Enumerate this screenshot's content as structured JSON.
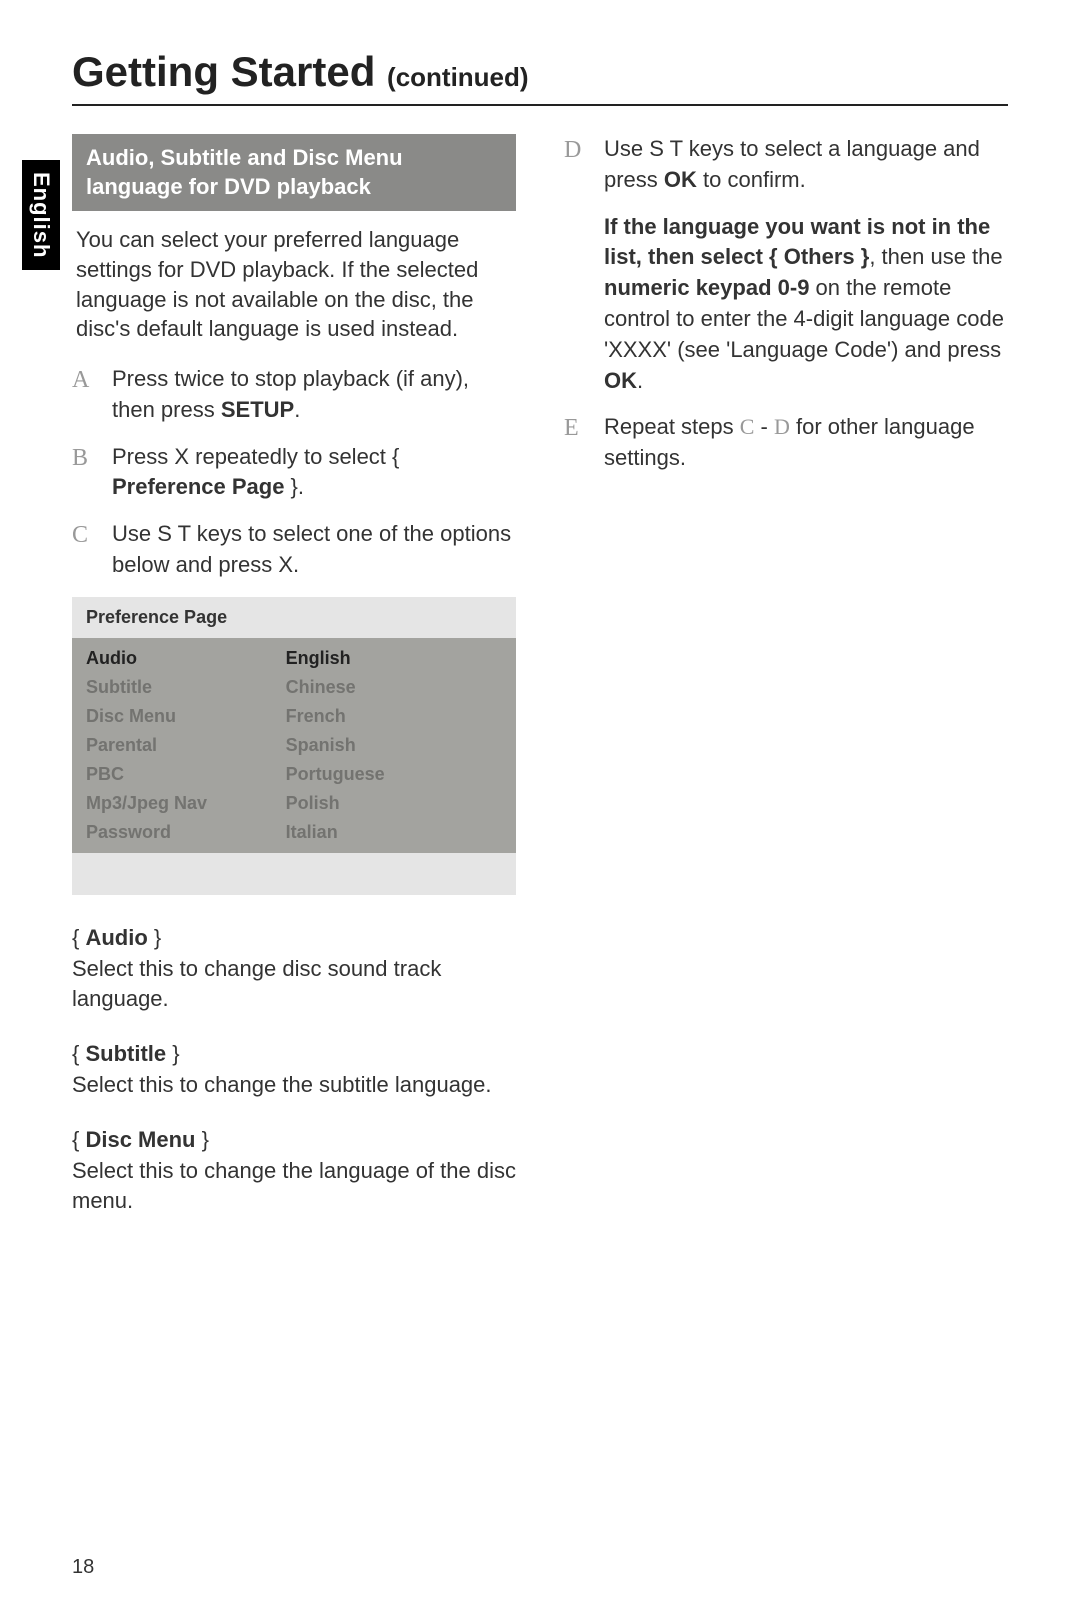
{
  "language_tab": "English",
  "heading": {
    "main": "Getting Started",
    "sub": "(continued)"
  },
  "left": {
    "section_header": "Audio, Subtitle and Disc Menu language for DVD playback",
    "intro": "You can select your preferred language settings for DVD playback. If the selected language is not available on the disc, the disc's default language is used instead.",
    "steps": [
      {
        "letter": "A",
        "pre": "Press ",
        "mid": " twice to stop playback (if any), then press ",
        "bold1": "SETUP",
        "post": "."
      },
      {
        "letter": "B",
        "pre": "Press  X repeatedly to select { ",
        "bold1": "Preference Page",
        "post": " }."
      },
      {
        "letter": "C",
        "pre": "Use  S T  keys to select one of the options below and press  X."
      }
    ],
    "pref_table": {
      "title": "Preference Page",
      "rows": [
        {
          "c1": "Audio",
          "c2": "English",
          "selected": true
        },
        {
          "c1": "Subtitle",
          "c2": "Chinese"
        },
        {
          "c1": "Disc Menu",
          "c2": "French"
        },
        {
          "c1": "Parental",
          "c2": "Spanish"
        },
        {
          "c1": "PBC",
          "c2": "Portuguese"
        },
        {
          "c1": "Mp3/Jpeg Nav",
          "c2": "Polish"
        },
        {
          "c1": "Password",
          "c2": "Italian"
        }
      ]
    },
    "options": [
      {
        "name": "Audio",
        "desc": "Select this to change disc sound track language."
      },
      {
        "name": "Subtitle",
        "desc": "Select this to change the subtitle language."
      },
      {
        "name": "Disc Menu",
        "desc": "Select this to change the language of the disc menu."
      }
    ]
  },
  "right": {
    "steps": [
      {
        "letter": "D",
        "html_parts": [
          {
            "t": "Use  S T  keys to select a language and press "
          },
          {
            "t": "OK",
            "b": true
          },
          {
            "t": " to confirm."
          }
        ]
      },
      {
        "letter": "",
        "html_parts": [
          {
            "t": "If the language you want is not in the list, then select { Others }",
            "b": true
          },
          {
            "t": ", then use the "
          },
          {
            "t": "numeric keypad 0-9",
            "b": true
          },
          {
            "t": " on the remote control to enter the 4-digit language code 'XXXX' (see 'Language Code') and press "
          },
          {
            "t": "OK",
            "b": true
          },
          {
            "t": "."
          }
        ]
      },
      {
        "letter": "E",
        "html_parts": [
          {
            "t": "Repeat steps "
          },
          {
            "t": "C",
            "lite": true
          },
          {
            "t": " - "
          },
          {
            "t": "D",
            "lite": true
          },
          {
            "t": "  for other language settings."
          }
        ]
      }
    ]
  },
  "page_number": "18"
}
